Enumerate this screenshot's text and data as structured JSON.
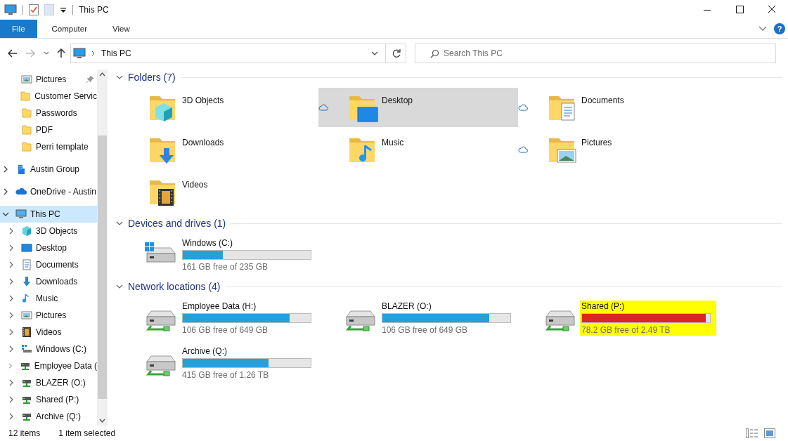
{
  "window": {
    "title": "This PC"
  },
  "ribbon": {
    "tabs": [
      {
        "label": "File",
        "selected": true
      },
      {
        "label": "Computer",
        "selected": false
      },
      {
        "label": "View",
        "selected": false
      }
    ],
    "help": "?"
  },
  "address": {
    "path": "This PC"
  },
  "search": {
    "placeholder": "Search This PC"
  },
  "sidebar": {
    "quick_access": [
      {
        "label": "Pictures",
        "kind": "pictures",
        "pinned": true
      },
      {
        "label": "Customer Servic",
        "kind": "folder",
        "pinned": false
      },
      {
        "label": "Passwords",
        "kind": "folder",
        "pinned": false
      },
      {
        "label": "PDF",
        "kind": "folder",
        "pinned": false
      },
      {
        "label": "Perri template",
        "kind": "folder",
        "pinned": false
      }
    ],
    "tree": [
      {
        "label": "Austin Group",
        "kind": "building",
        "expanded": false,
        "selected": false
      },
      {
        "label": "OneDrive - Austin",
        "kind": "onedrive",
        "expanded": false,
        "selected": false
      },
      {
        "label": "This PC",
        "kind": "pc",
        "expanded": true,
        "selected": true,
        "children": [
          {
            "label": "3D Objects",
            "kind": "cube",
            "expanded": false,
            "selected": false
          },
          {
            "label": "Desktop",
            "kind": "desktop",
            "expanded": false,
            "selected": false
          },
          {
            "label": "Documents",
            "kind": "documents",
            "expanded": false,
            "selected": false
          },
          {
            "label": "Downloads",
            "kind": "downloads",
            "expanded": false,
            "selected": false
          },
          {
            "label": "Music",
            "kind": "music",
            "expanded": false,
            "selected": false
          },
          {
            "label": "Pictures",
            "kind": "pictures",
            "expanded": false,
            "selected": false
          },
          {
            "label": "Videos",
            "kind": "videos",
            "expanded": false,
            "selected": false
          },
          {
            "label": "Windows (C:)",
            "kind": "windows-drive",
            "expanded": false,
            "selected": false
          },
          {
            "label": "Employee Data (",
            "kind": "network-drive",
            "expanded": false,
            "selected": false
          },
          {
            "label": "BLAZER (O:)",
            "kind": "network-drive",
            "expanded": false,
            "selected": false
          },
          {
            "label": "Shared (P:)",
            "kind": "network-drive",
            "expanded": false,
            "selected": false
          },
          {
            "label": "Archive (Q:)",
            "kind": "network-drive",
            "expanded": false,
            "selected": false
          }
        ]
      }
    ]
  },
  "folders": {
    "title": "Folders (7)",
    "items": [
      {
        "label": "3D Objects",
        "kind": "cube",
        "cloud": false,
        "selected": false
      },
      {
        "label": "Desktop",
        "kind": "desktop",
        "cloud": true,
        "selected": true
      },
      {
        "label": "Documents",
        "kind": "documents",
        "cloud": true,
        "selected": false
      },
      {
        "label": "Downloads",
        "kind": "downloads",
        "cloud": false,
        "selected": false
      },
      {
        "label": "Music",
        "kind": "music",
        "cloud": false,
        "selected": false
      },
      {
        "label": "Pictures",
        "kind": "pictures",
        "cloud": true,
        "selected": false
      },
      {
        "label": "Videos",
        "kind": "videos",
        "cloud": false,
        "selected": false
      }
    ]
  },
  "devices": {
    "title": "Devices and drives (1)",
    "items": [
      {
        "name": "Windows (C:)",
        "kind": "windows-drive",
        "level": 0.315,
        "free": "161 GB free of 235 GB",
        "low_space": false,
        "highlighted": false
      }
    ]
  },
  "network": {
    "title": "Network locations (4)",
    "items": [
      {
        "name": "Employee Data (H:)",
        "kind": "network-drive",
        "level": 0.837,
        "free": "106 GB free of 649 GB",
        "low_space": false,
        "highlighted": false
      },
      {
        "name": "BLAZER (O:)",
        "kind": "network-drive",
        "level": 0.837,
        "free": "106 GB free of 649 GB",
        "low_space": false,
        "highlighted": false
      },
      {
        "name": "Shared (P:)",
        "kind": "network-drive",
        "level": 0.969,
        "free": "78.2 GB free of 2.49 TB",
        "low_space": true,
        "highlighted": true
      },
      {
        "name": "Archive (Q:)",
        "kind": "network-drive",
        "level": 0.67,
        "free": "415 GB free of 1.26 TB",
        "low_space": false,
        "highlighted": false
      }
    ]
  },
  "status_bar": {
    "count": "12 items",
    "selection": "1 item selected"
  }
}
